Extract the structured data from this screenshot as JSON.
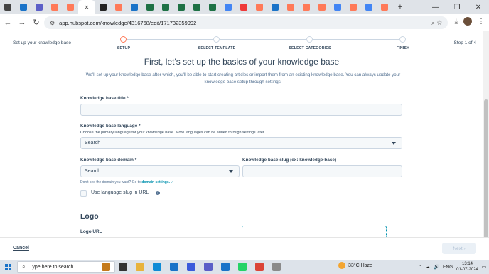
{
  "browser": {
    "url": "app.hubspot.com/knowledge/4316768/edit/171732359992",
    "window_controls": [
      "—",
      "❐",
      "✕"
    ],
    "tabs": [
      {
        "icon": "chrome-menu-icon",
        "color": "#444444"
      },
      {
        "icon": "outlook-icon",
        "color": "#1a73c8"
      },
      {
        "icon": "teams-icon",
        "color": "#5b5fc7"
      },
      {
        "icon": "hubspot-icon",
        "color": "#ff7a59"
      },
      {
        "icon": "hubspot-icon",
        "color": "#ff7a59"
      },
      {
        "icon": "close-icon",
        "color": "#444444",
        "active": true
      },
      {
        "icon": "github-icon",
        "color": "#222222"
      },
      {
        "icon": "hubspot-icon",
        "color": "#ff7a59"
      },
      {
        "icon": "settings-icon",
        "color": "#1a73c8"
      },
      {
        "icon": "excel-icon",
        "color": "#1e7145"
      },
      {
        "icon": "excel-icon",
        "color": "#1e7145"
      },
      {
        "icon": "excel-icon",
        "color": "#1e7145"
      },
      {
        "icon": "excel-icon",
        "color": "#1e7145"
      },
      {
        "icon": "excel-icon",
        "color": "#1e7145"
      },
      {
        "icon": "google-icon",
        "color": "#4285f4"
      },
      {
        "icon": "vivaldi-icon",
        "color": "#ef3939"
      },
      {
        "icon": "hubspot-icon",
        "color": "#ff7a59"
      },
      {
        "icon": "tableau-icon",
        "color": "#1a73c8"
      },
      {
        "icon": "hubspot-icon",
        "color": "#ff7a59"
      },
      {
        "icon": "hubspot-icon",
        "color": "#ff7a59"
      },
      {
        "icon": "hubspot-icon",
        "color": "#ff7a59"
      },
      {
        "icon": "google-icon",
        "color": "#4285f4"
      },
      {
        "icon": "hubspot-icon",
        "color": "#ff7a59"
      },
      {
        "icon": "google-icon",
        "color": "#4285f4"
      },
      {
        "icon": "hubspot-icon",
        "color": "#ff7a59"
      }
    ],
    "new_tab": "+"
  },
  "wizard": {
    "setup_label": "Set up your knowledge base",
    "step_of": "Step 1 of 4",
    "steps": [
      "SETUP",
      "SELECT TEMPLATE",
      "SELECT CATEGORIES",
      "FINISH"
    ],
    "active_step": 0,
    "heading": "First, let's set up the basics of your knowledge base",
    "intro": "We'll set up your knowledge base after which, you'll be able to start creating articles or import them from an existing knowledge base. You can always update your knowledge base setup through settings."
  },
  "form": {
    "title_label": "Knowledge base title *",
    "title_value": "",
    "language_label": "Knowledge base language *",
    "language_help": "Choose the primary language for your knowledge base. More languages can be added through settings later.",
    "language_value": "Search",
    "domain_label": "Knowledge base domain *",
    "domain_value": "Search",
    "slug_label": "Knowledge base slug (ex: knowledge-base)",
    "slug_value": "",
    "domain_help_prefix": "Don't see the domain you want? Go to",
    "domain_help_link": "domain settings.",
    "language_slug_label": "Use language slug in URL",
    "language_slug_checked": false,
    "logo_heading": "Logo",
    "logo_url_label": "Logo URL"
  },
  "footer": {
    "cancel": "Cancel",
    "next": "Next"
  },
  "taskbar": {
    "search_placeholder": "Type here to search",
    "weather": "33°C  Haze",
    "lang": "ENG",
    "time": "13:14",
    "date": "01-07-2024",
    "pinned": [
      {
        "icon": "briefcase-icon",
        "color": "#c47a1c"
      },
      {
        "icon": "task-view-icon",
        "color": "#333333"
      },
      {
        "icon": "file-explorer-icon",
        "color": "#e8b33c"
      },
      {
        "icon": "edge-icon",
        "color": "#0f8bd6"
      },
      {
        "icon": "mail-icon",
        "color": "#1a73c8"
      },
      {
        "icon": "app-icon",
        "color": "#3b5bdb"
      },
      {
        "icon": "teams-icon",
        "color": "#5b5fc7"
      },
      {
        "icon": "outlook-icon",
        "color": "#1a73c8"
      },
      {
        "icon": "whatsapp-icon",
        "color": "#25d366"
      },
      {
        "icon": "chrome-icon",
        "color": "#db4437"
      },
      {
        "icon": "app-icon",
        "color": "#8a8a8a"
      }
    ]
  },
  "colors": {
    "accent": "#ff7a59",
    "link": "#0091ae",
    "text": "#33475b",
    "input_bg": "#f5f8fa",
    "input_border": "#cbd6e2"
  }
}
